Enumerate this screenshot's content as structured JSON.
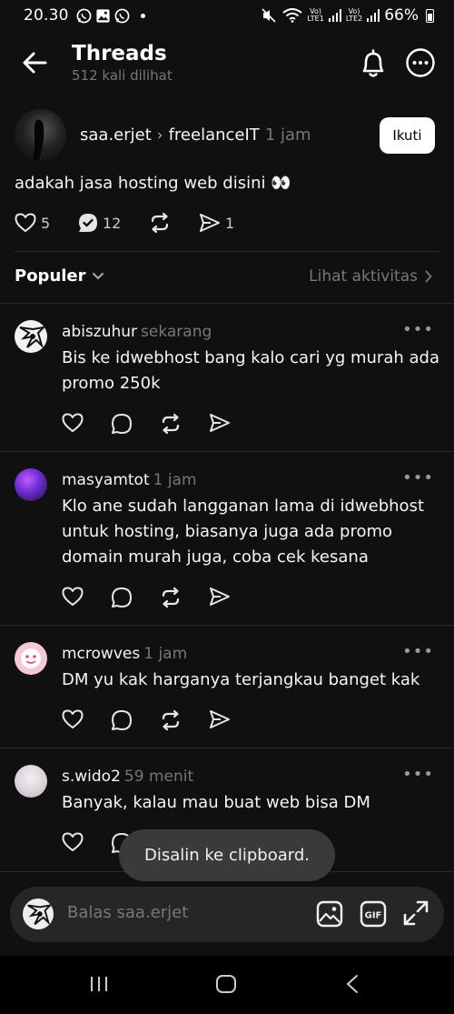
{
  "status_bar": {
    "time": "20.30",
    "battery": "66%",
    "sim1": "LTE1",
    "sim2": "LTE2"
  },
  "header": {
    "title": "Threads",
    "views": "512 kali dilihat"
  },
  "post": {
    "author": "saa.erjet",
    "topic": "freelanceIT",
    "time": "1 jam",
    "follow_label": "Ikuti",
    "text": "adakah jasa hosting web disini 👀",
    "likes": "5",
    "replies": "12",
    "shares": "1"
  },
  "sort": {
    "label": "Populer",
    "activity_link": "Lihat aktivitas"
  },
  "replies": [
    {
      "user": "abiszuhur",
      "time": "sekarang",
      "text": "Bis ke idwebhost bang kalo cari yg murah ada promo 250k"
    },
    {
      "user": "masyamtot",
      "time": "1 jam",
      "text": "Klo ane sudah langganan lama di idwebhost untuk hosting, biasanya juga ada promo domain murah juga, coba cek kesana"
    },
    {
      "user": "mcrowves",
      "time": "1 jam",
      "text": "DM yu kak harganya terjangkau banget kak"
    },
    {
      "user": "s.wido2",
      "time": "59 menit",
      "text": "Banyak, kalau mau buat web bisa DM"
    }
  ],
  "toast": "Disalin ke clipboard.",
  "composer": {
    "placeholder": "Balas saa.erjet"
  },
  "colors": {
    "background": "#101010",
    "text": "#f3f5f7",
    "muted": "#777777",
    "divider": "#2a2a2a"
  }
}
